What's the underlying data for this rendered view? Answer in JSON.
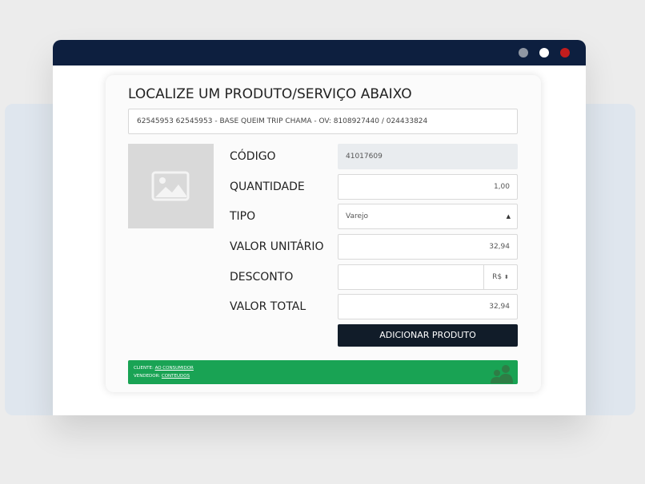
{
  "window": {
    "controls": [
      "gray-dot",
      "white-dot",
      "red-dot"
    ],
    "colors": {
      "titlebar": "#0d1f3f",
      "close": "#c21d1d",
      "accent": "#19a354"
    }
  },
  "form": {
    "heading": "LOCALIZE UM PRODUTO/SERVIÇO ABAIXO",
    "search_value": "62545953 62545953 - BASE QUEIM TRIP CHAMA - OV: 8108927440 / 024433824",
    "product_image_icon": "image-placeholder-icon",
    "fields": {
      "codigo": {
        "label": "CÓDIGO",
        "value": "41017609"
      },
      "quantidade": {
        "label": "QUANTIDADE",
        "value": "1,00"
      },
      "tipo": {
        "label": "TIPO",
        "value": "Varejo"
      },
      "valor_unitario": {
        "label": "VALOR UNITÁRIO",
        "value": "32,94"
      },
      "desconto": {
        "label": "DESCONTO",
        "value": "",
        "currency": "R$"
      },
      "valor_total": {
        "label": "VALOR TOTAL",
        "value": "32,94"
      }
    },
    "add_button": "ADICIONAR PRODUTO"
  },
  "status": {
    "cliente_label": "CLIENTE:",
    "cliente_value": "AO CONSUMIDOR",
    "vendedor_label": "VENDEDOR:",
    "vendedor_value": "CONTEUDOS",
    "icon": "users-icon"
  }
}
